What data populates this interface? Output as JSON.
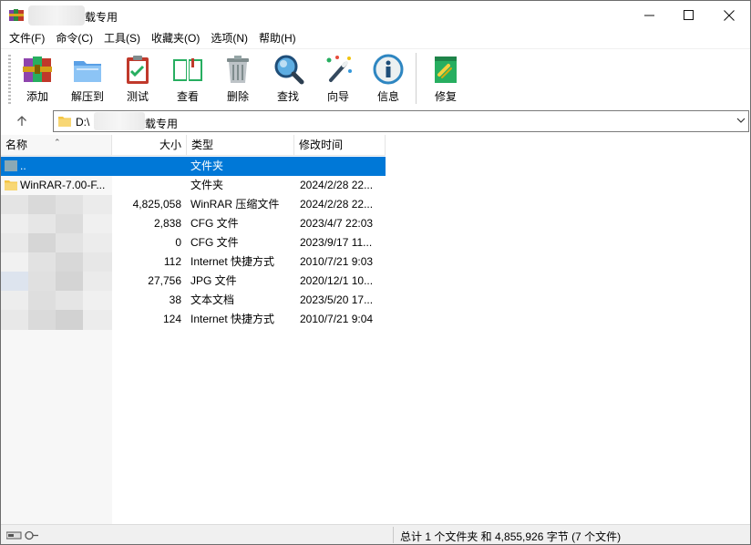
{
  "window": {
    "title_suffix": "载专用",
    "controls": {
      "minimize": "minimize",
      "maximize": "maximize",
      "close": "close"
    }
  },
  "menu": [
    "文件(F)",
    "命令(C)",
    "工具(S)",
    "收藏夹(O)",
    "选项(N)",
    "帮助(H)"
  ],
  "toolbar": [
    {
      "label": "添加",
      "icon": "archive-books-icon"
    },
    {
      "label": "解压到",
      "icon": "folder-extract-icon"
    },
    {
      "label": "测试",
      "icon": "clipboard-check-icon"
    },
    {
      "label": "查看",
      "icon": "open-book-icon"
    },
    {
      "label": "删除",
      "icon": "trash-can-icon"
    },
    {
      "label": "查找",
      "icon": "magnifier-icon"
    },
    {
      "label": "向导",
      "icon": "magic-wand-icon"
    },
    {
      "label": "信息",
      "icon": "info-icon"
    },
    {
      "label": "修复",
      "icon": "repair-box-icon"
    }
  ],
  "address": {
    "prefix": "D:\\",
    "suffix": "载专用"
  },
  "columns": {
    "name": "名称",
    "size": "大小",
    "type": "类型",
    "modified": "修改时间"
  },
  "rows": [
    {
      "name": "..",
      "size": "",
      "type": "文件夹",
      "modified": "",
      "icon": "parent-folder-icon",
      "selected": true
    },
    {
      "name": "WinRAR-7.00-F...",
      "size": "",
      "type": "文件夹",
      "modified": "2024/2/28 22...",
      "icon": "folder-icon",
      "selected": false
    },
    {
      "name": "",
      "size": "4,825,058",
      "type": "WinRAR 压缩文件",
      "modified": "2024/2/28 22...",
      "icon": "",
      "selected": false
    },
    {
      "name": "",
      "size": "2,838",
      "type": "CFG 文件",
      "modified": "2023/4/7 22:03",
      "icon": "",
      "selected": false
    },
    {
      "name": "",
      "size": "0",
      "type": "CFG 文件",
      "modified": "2023/9/17 11...",
      "icon": "",
      "selected": false
    },
    {
      "name": "",
      "size": "112",
      "type": "Internet 快捷方式",
      "modified": "2010/7/21 9:03",
      "icon": "",
      "selected": false
    },
    {
      "name": "",
      "size": "27,756",
      "type": "JPG 文件",
      "modified": "2020/12/1 10...",
      "icon": "",
      "selected": false
    },
    {
      "name": "",
      "size": "38",
      "type": "文本文档",
      "modified": "2023/5/20 17...",
      "icon": "",
      "selected": false
    },
    {
      "name": "",
      "size": "124",
      "type": "Internet 快捷方式",
      "modified": "2010/7/21 9:04",
      "icon": "",
      "selected": false
    }
  ],
  "status": {
    "summary": "总计 1 个文件夹 和 4,855,926 字节 (7 个文件)"
  },
  "colors": {
    "selection": "#0078d7",
    "folder": "#f4c542",
    "accent_blue": "#1e6fd9"
  }
}
